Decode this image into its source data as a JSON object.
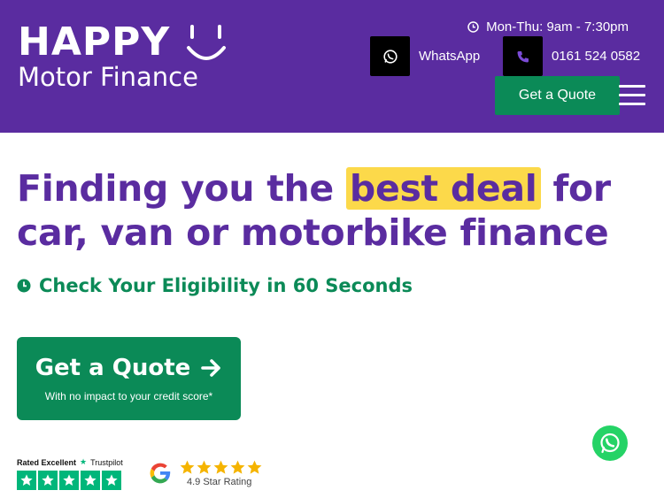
{
  "header": {
    "logo_main": "HAPPY",
    "logo_sub": "Motor Finance",
    "hours": "Mon-Thu: 9am - 7:30pm",
    "whatsapp_label": "WhatsApp",
    "phone": "0161 524 0582",
    "quote_button": "Get a Quote",
    "icons": [
      "clock-icon",
      "whatsapp-icon",
      "phone-icon",
      "menu-icon"
    ]
  },
  "hero": {
    "headline_pre": "Finding you the ",
    "headline_highlight": "best deal",
    "headline_post": " for car, van or motorbike finance",
    "eligibility": "Check Your Eligibility in 60 Seconds",
    "cta_label": "Get a Quote",
    "cta_sub": "With no impact to your credit score*"
  },
  "ratings": {
    "trustpilot_rating": "Rated Excellent",
    "trustpilot_brand": "Trustpilot",
    "google_rating": "4.9 Star Rating"
  },
  "colors": {
    "brand_purple": "#5a2ca0",
    "brand_green": "#0b8a57",
    "highlight_yellow": "#fcd94a",
    "trustpilot_green": "#00b67a",
    "star_gold": "#f5b400"
  }
}
